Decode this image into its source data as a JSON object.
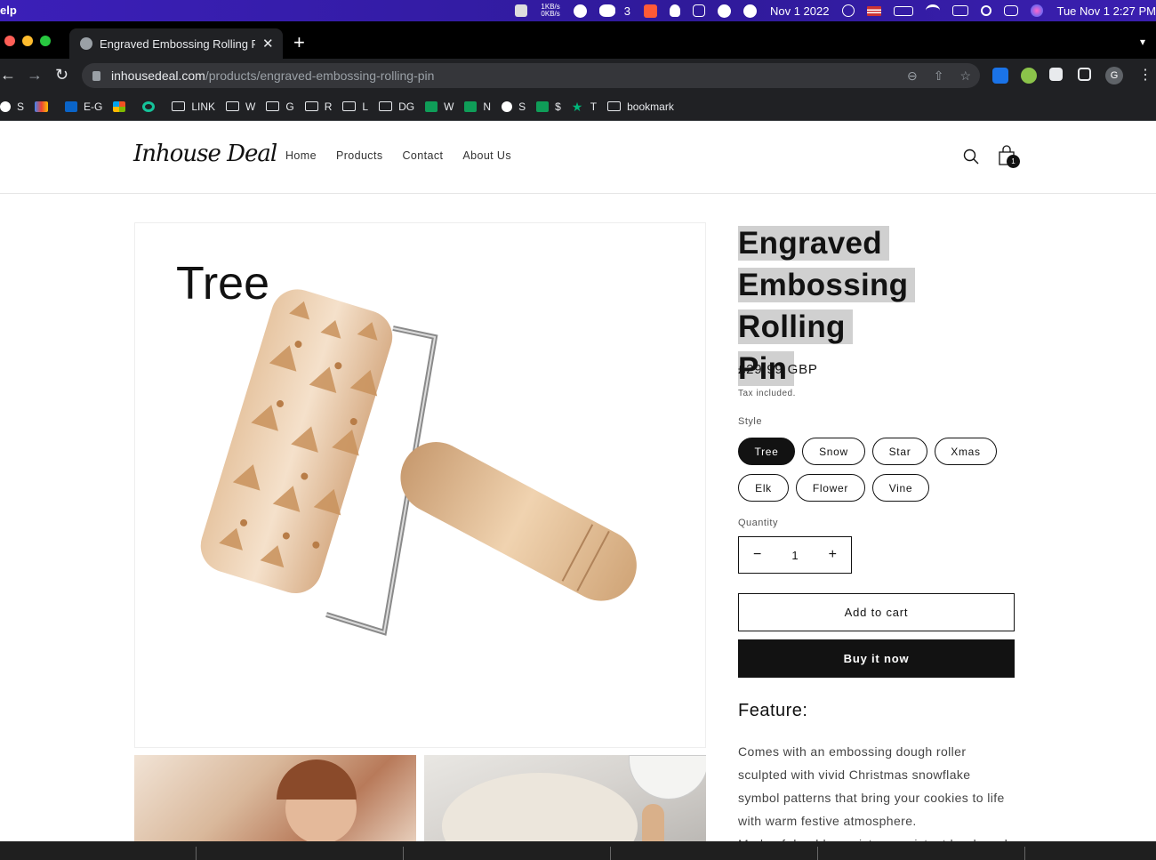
{
  "menubar": {
    "app_name": "elp",
    "net_up": "1KB/s",
    "net_down": "0KB/s",
    "wechat_count": "3",
    "date_short": "Nov 1 2022",
    "datetime": "Tue Nov 1  2:27 PM"
  },
  "browser": {
    "tab_title": "Engraved Embossing Rolling Pin",
    "url_host": "inhousedeal.com",
    "url_path": "/products/engraved-embossing-rolling-pin",
    "profile_initial": "G",
    "bookmarks": [
      "S",
      "",
      "E-G",
      "",
      "",
      "LINK",
      "W",
      "G",
      "R",
      "L",
      "DG",
      "W",
      "N",
      "S",
      "$",
      "T",
      "bookmark"
    ]
  },
  "site": {
    "logo": "Inhouse Deal",
    "nav": [
      "Home",
      "Products",
      "Contact",
      "About Us"
    ],
    "cart_count": "1"
  },
  "product": {
    "media_label": "Tree",
    "title_lines": [
      "Engraved",
      "Embossing Rolling",
      "Pin"
    ],
    "price": "£29.99 GBP",
    "tax_note": "Tax included.",
    "style_label": "Style",
    "styles": [
      "Tree",
      "Snow",
      "Star",
      "Xmas",
      "Elk",
      "Flower",
      "Vine"
    ],
    "selected_style": "Tree",
    "quantity_label": "Quantity",
    "quantity": "1",
    "add_to_cart": "Add to cart",
    "buy_now": "Buy it now",
    "feature_heading": "Feature:",
    "feature_text": "Comes with an embossing dough roller sculpted with vivid Christmas snowflake symbol patterns that bring your cookies to life with warm festive atmosphere.",
    "feature_text_cut": "Made of durable, moisture-resistant hardwood"
  },
  "colors": {
    "menubar": "#2f1a9a",
    "chrome_dark": "#202124",
    "accent_black": "#121212",
    "title_highlight": "#d0d0d0"
  }
}
